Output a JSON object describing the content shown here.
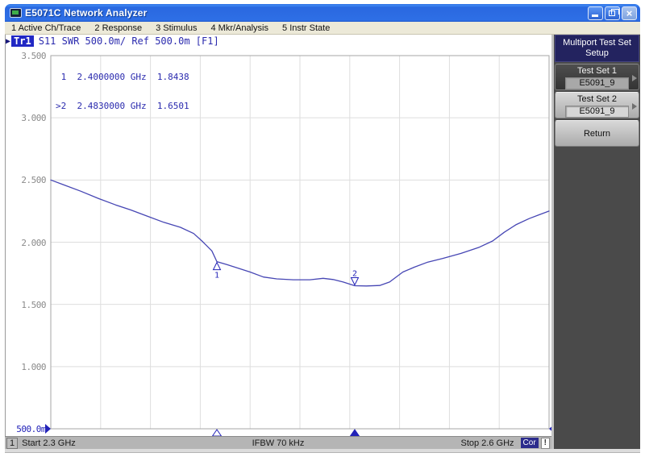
{
  "window": {
    "title": "E5071C Network Analyzer",
    "close_glyph": "×"
  },
  "menu": {
    "items": [
      "1 Active Ch/Trace",
      "2 Response",
      "3 Stimulus",
      "4 Mkr/Analysis",
      "5 Instr State"
    ]
  },
  "trace_bar": {
    "trace_label": "Tr1",
    "settings_text": "S11 SWR 500.0m/ Ref 500.0m [F1]"
  },
  "marker_readout": {
    "lines": [
      " 1  2.4000000 GHz  1.8438",
      ">2  2.4830000 GHz  1.6501"
    ]
  },
  "chart_data": {
    "type": "line",
    "xlim": [
      2.3,
      2.6
    ],
    "ylim": [
      0.5,
      3.5
    ],
    "x_divisions": 10,
    "y_divisions": 6,
    "grid": true,
    "ref_level": 0.5,
    "y_ticks": [
      {
        "v": 3.5,
        "label": "3.500"
      },
      {
        "v": 3.0,
        "label": "3.000"
      },
      {
        "v": 2.5,
        "label": "2.500"
      },
      {
        "v": 2.0,
        "label": "2.000"
      },
      {
        "v": 1.5,
        "label": "1.500"
      },
      {
        "v": 1.0,
        "label": "1.000"
      },
      {
        "v": 0.5,
        "label": "500.0m",
        "accent": true
      }
    ],
    "series": [
      {
        "name": "Tr1 S11 SWR",
        "color": "#4646b4",
        "end_label": "1",
        "points": [
          [
            2.3,
            2.5
          ],
          [
            2.308,
            2.46
          ],
          [
            2.318,
            2.41
          ],
          [
            2.329,
            2.35
          ],
          [
            2.339,
            2.3
          ],
          [
            2.348,
            2.26
          ],
          [
            2.358,
            2.21
          ],
          [
            2.368,
            2.16
          ],
          [
            2.378,
            2.12
          ],
          [
            2.386,
            2.07
          ],
          [
            2.391,
            2.01
          ],
          [
            2.397,
            1.93
          ],
          [
            2.4,
            1.844
          ],
          [
            2.406,
            1.82
          ],
          [
            2.413,
            1.79
          ],
          [
            2.42,
            1.76
          ],
          [
            2.428,
            1.72
          ],
          [
            2.436,
            1.705
          ],
          [
            2.446,
            1.698
          ],
          [
            2.456,
            1.698
          ],
          [
            2.464,
            1.71
          ],
          [
            2.47,
            1.7
          ],
          [
            2.476,
            1.68
          ],
          [
            2.483,
            1.65
          ],
          [
            2.49,
            1.648
          ],
          [
            2.498,
            1.652
          ],
          [
            2.504,
            1.68
          ],
          [
            2.512,
            1.76
          ],
          [
            2.519,
            1.8
          ],
          [
            2.527,
            1.84
          ],
          [
            2.536,
            1.87
          ],
          [
            2.547,
            1.91
          ],
          [
            2.558,
            1.96
          ],
          [
            2.566,
            2.01
          ],
          [
            2.573,
            2.08
          ],
          [
            2.58,
            2.14
          ],
          [
            2.588,
            2.19
          ],
          [
            2.594,
            2.22
          ],
          [
            2.6,
            2.25
          ]
        ]
      }
    ],
    "markers": [
      {
        "n": "1",
        "freq_ghz": 2.4,
        "value": 1.8438,
        "active": false
      },
      {
        "n": "2",
        "freq_ghz": 2.483,
        "value": 1.6501,
        "active": true
      }
    ]
  },
  "sidebar": {
    "header_line1": "Multiport Test Set",
    "header_line2": "Setup",
    "buttons": [
      {
        "label": "Test Set 1",
        "value": "E5091_9"
      },
      {
        "label": "Test Set 2",
        "value": "E5091_9"
      },
      {
        "label": "Return"
      }
    ]
  },
  "status_bar": {
    "channel": "1",
    "start": "Start 2.3 GHz",
    "ifbw": "IFBW 70 kHz",
    "stop": "Stop 2.6 GHz",
    "cor": "Cor",
    "warn": "!"
  },
  "colors": {
    "trace": "#4646b4",
    "marker_blue": "#2323b8",
    "cor_badge_bg": "#2b2b8c",
    "softkey_header_bg": "#23235f",
    "sidebar_bg": "#4a4a4a",
    "titlebar_blue": "#2e6fe6"
  }
}
